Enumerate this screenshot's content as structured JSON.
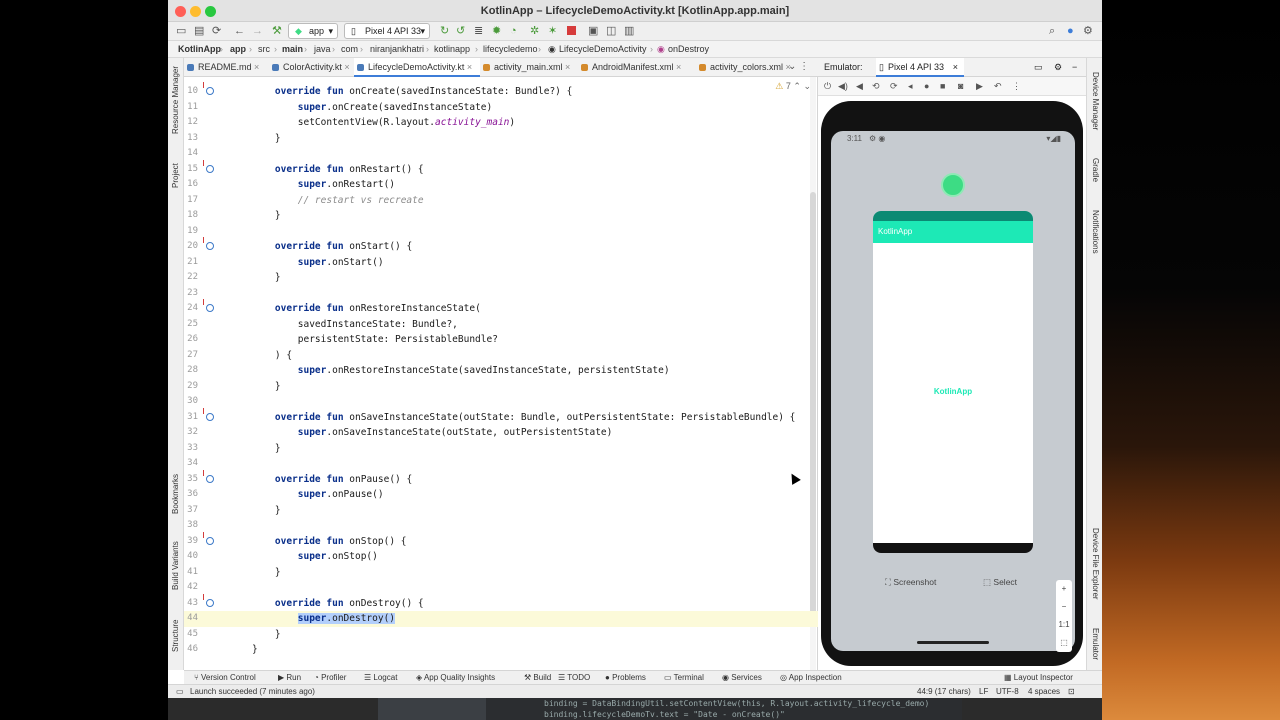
{
  "window": {
    "title": "KotlinApp – LifecycleDemoActivity.kt [KotlinApp.app.main]"
  },
  "toolbar": {
    "run_config": "app",
    "device": "Pixel 4 API 33"
  },
  "breadcrumb": [
    "KotlinApp",
    "app",
    "src",
    "main",
    "java",
    "com",
    "niranjankhatri",
    "kotlinapp",
    "lifecycledemo",
    "LifecycleDemoActivity",
    "onDestroy"
  ],
  "tabs": [
    {
      "label": "README.md",
      "icon_color": "#4a7ab8",
      "active": false
    },
    {
      "label": "ColorActivity.kt",
      "icon_color": "#4a7ab8",
      "active": false
    },
    {
      "label": "LifecycleDemoActivity.kt",
      "icon_color": "#4a7ab8",
      "active": true
    },
    {
      "label": "activity_main.xml",
      "icon_color": "#d48a2c",
      "active": false
    },
    {
      "label": "AndroidManifest.xml",
      "icon_color": "#d48a2c",
      "active": false
    },
    {
      "label": "activity_colors.xml",
      "icon_color": "#d48a2c",
      "active": false
    }
  ],
  "editor": {
    "warning_count": "7",
    "lines": [
      {
        "n": "10",
        "text": "    override fun onCreate(savedInstanceState: Bundle?) {",
        "marker": true
      },
      {
        "n": "11",
        "text": "        super.onCreate(savedInstanceState)"
      },
      {
        "n": "12",
        "text": "        setContentView(R.layout.activity_main)"
      },
      {
        "n": "13",
        "text": "    }"
      },
      {
        "n": "14",
        "text": ""
      },
      {
        "n": "15",
        "text": "    override fun onRestart() {",
        "marker": true
      },
      {
        "n": "16",
        "text": "        super.onRestart()"
      },
      {
        "n": "17",
        "text": "        // restart vs recreate"
      },
      {
        "n": "18",
        "text": "    }"
      },
      {
        "n": "19",
        "text": ""
      },
      {
        "n": "20",
        "text": "    override fun onStart() {",
        "marker": true
      },
      {
        "n": "21",
        "text": "        super.onStart()"
      },
      {
        "n": "22",
        "text": "    }"
      },
      {
        "n": "23",
        "text": ""
      },
      {
        "n": "24",
        "text": "    override fun onRestoreInstanceState(",
        "marker": true
      },
      {
        "n": "25",
        "text": "        savedInstanceState: Bundle?,"
      },
      {
        "n": "26",
        "text": "        persistentState: PersistableBundle?"
      },
      {
        "n": "27",
        "text": "    ) {"
      },
      {
        "n": "28",
        "text": "        super.onRestoreInstanceState(savedInstanceState, persistentState)"
      },
      {
        "n": "29",
        "text": "    }"
      },
      {
        "n": "30",
        "text": ""
      },
      {
        "n": "31",
        "text": "    override fun onSaveInstanceState(outState: Bundle, outPersistentState: PersistableBundle) {",
        "marker": true
      },
      {
        "n": "32",
        "text": "        super.onSaveInstanceState(outState, outPersistentState)"
      },
      {
        "n": "33",
        "text": "    }"
      },
      {
        "n": "34",
        "text": ""
      },
      {
        "n": "35",
        "text": "    override fun onPause() {",
        "marker": true
      },
      {
        "n": "36",
        "text": "        super.onPause()"
      },
      {
        "n": "37",
        "text": "    }"
      },
      {
        "n": "38",
        "text": ""
      },
      {
        "n": "39",
        "text": "    override fun onStop() {",
        "marker": true
      },
      {
        "n": "40",
        "text": "        super.onStop()"
      },
      {
        "n": "41",
        "text": "    }"
      },
      {
        "n": "42",
        "text": ""
      },
      {
        "n": "43",
        "text": "    override fun onDestroy() {",
        "marker": true
      },
      {
        "n": "44",
        "text": "        super.onDestroy()",
        "caret": true,
        "selected": true
      },
      {
        "n": "45",
        "text": "    }"
      },
      {
        "n": "46",
        "text": "}"
      }
    ]
  },
  "emulator": {
    "label": "Emulator:",
    "device_tab": "Pixel 4 API 33",
    "status_time": "3:11",
    "app_title": "KotlinApp",
    "app_center_text": "KotlinApp",
    "screenshot_label": "Screenshot",
    "select_label": "Select",
    "zoom_in": "+",
    "zoom_out": "−",
    "zoom_ratio": "1:1"
  },
  "left_tools": [
    "Resource Manager",
    "Project",
    "Bookmarks",
    "Build Variants",
    "Structure"
  ],
  "right_tools": [
    "Device Manager",
    "Gradle",
    "Notifications",
    "Device File Explorer",
    "Emulator"
  ],
  "bottom_tools": [
    "Version Control",
    "Run",
    "Profiler",
    "Logcat",
    "App Quality Insights",
    "Build",
    "TODO",
    "Problems",
    "Terminal",
    "Services",
    "App Inspection",
    "Layout Inspector"
  ],
  "statusbar": {
    "message": "Launch succeeded (7 minutes ago)",
    "position": "44:9 (17 chars)",
    "line_sep": "LF",
    "encoding": "UTF-8",
    "indent": "4 spaces"
  },
  "background_code": "binding = DataBindingUtil.setContentView(this, R.layout.activity_lifecycle_demo)\nbinding.lifecycleDemoTv.text = \"Date - onCreate()\"",
  "colors": {
    "accent": "#1de9b6",
    "selection": "#b3cffb",
    "caret_line": "#fcfad9",
    "keyword": "#0a2f8a"
  }
}
